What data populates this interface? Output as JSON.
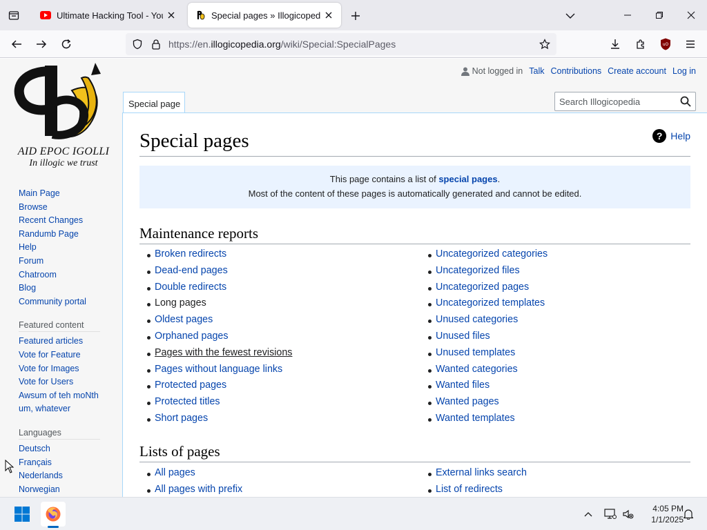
{
  "browser": {
    "tabs": [
      {
        "title": "Ultimate Hacking Tool - YouTube",
        "active": false
      },
      {
        "title": "Special pages » Illogicopedia - The Nonsensical Encyclopedia",
        "active": true
      }
    ],
    "url_prefix": "https://en.",
    "url_domain": "illogicopedia.org",
    "url_path": "/wiki/Special:SpecialPages"
  },
  "logo": {
    "caption": "AID EPOC IGOLLI",
    "tagline": "In illogic we trust"
  },
  "sidebar": {
    "nav": [
      "Main Page",
      "Browse",
      "Recent Changes",
      "Randumb Page",
      "Help",
      "Forum",
      "Chatroom",
      "Blog",
      "Community portal"
    ],
    "featured_heading": "Featured content",
    "featured": [
      "Featured articles",
      "Vote for Feature",
      "Vote for Images",
      "Vote for Users",
      "Awsum of teh moNth",
      "um, whatever"
    ],
    "languages_heading": "Languages",
    "languages": [
      "Deutsch",
      "Français",
      "Nederlands",
      "Norwegian"
    ]
  },
  "personal": {
    "not_logged_in": "Not logged in",
    "talk": "Talk",
    "contributions": "Contributions",
    "create_account": "Create account",
    "log_in": "Log in"
  },
  "tabs": {
    "special_page": "Special page"
  },
  "search": {
    "placeholder": "Search Illogicopedia"
  },
  "content": {
    "title": "Special pages",
    "help": "Help",
    "notice_prefix": "This page contains a list of ",
    "notice_link": "special pages",
    "notice_suffix": ".",
    "notice_line2": "Most of the content of these pages is automatically generated and cannot be edited.",
    "maintenance_heading": "Maintenance reports",
    "maintenance_left": [
      "Broken redirects",
      "Dead-end pages",
      "Double redirects",
      "Long pages",
      "Oldest pages",
      "Orphaned pages",
      "Pages with the fewest revisions",
      "Pages without language links",
      "Protected pages",
      "Protected titles",
      "Short pages"
    ],
    "maintenance_right": [
      "Uncategorized categories",
      "Uncategorized files",
      "Uncategorized pages",
      "Uncategorized templates",
      "Unused categories",
      "Unused files",
      "Unused templates",
      "Wanted categories",
      "Wanted files",
      "Wanted pages",
      "Wanted templates"
    ],
    "lists_heading": "Lists of pages",
    "lists_left": [
      "All pages",
      "All pages with prefix"
    ],
    "lists_right": [
      "External links search",
      "List of redirects"
    ]
  },
  "taskbar": {
    "time": "4:05 PM",
    "date": "1/1/2025"
  }
}
